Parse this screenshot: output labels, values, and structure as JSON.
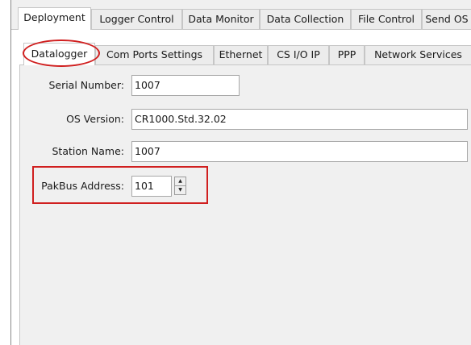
{
  "top_tabs": [
    {
      "label": "Deployment",
      "active": true
    },
    {
      "label": "Logger Control",
      "active": false
    },
    {
      "label": "Data Monitor",
      "active": false
    },
    {
      "label": "Data Collection",
      "active": false
    },
    {
      "label": "File Control",
      "active": false
    },
    {
      "label": "Send OS",
      "active": false
    }
  ],
  "sub_tabs": [
    {
      "label": "Datalogger",
      "active": true
    },
    {
      "label": "Com Ports Settings",
      "active": false
    },
    {
      "label": "Ethernet",
      "active": false
    },
    {
      "label": "CS I/O IP",
      "active": false
    },
    {
      "label": "PPP",
      "active": false
    },
    {
      "label": "Network Services",
      "active": false
    }
  ],
  "form": {
    "serial_number": {
      "label": "Serial Number:",
      "value": "1007"
    },
    "os_version": {
      "label": "OS Version:",
      "value": "CR1000.Std.32.02"
    },
    "station_name": {
      "label": "Station Name:",
      "value": "1007"
    },
    "pakbus_address": {
      "label": "PakBus Address:",
      "value": "101"
    }
  },
  "icons": {
    "spin_up": "▲",
    "spin_down": "▼"
  },
  "colors": {
    "highlight": "#d01f1f",
    "active_tab": "#ffffff",
    "panel_background": "#f0f0f0"
  }
}
